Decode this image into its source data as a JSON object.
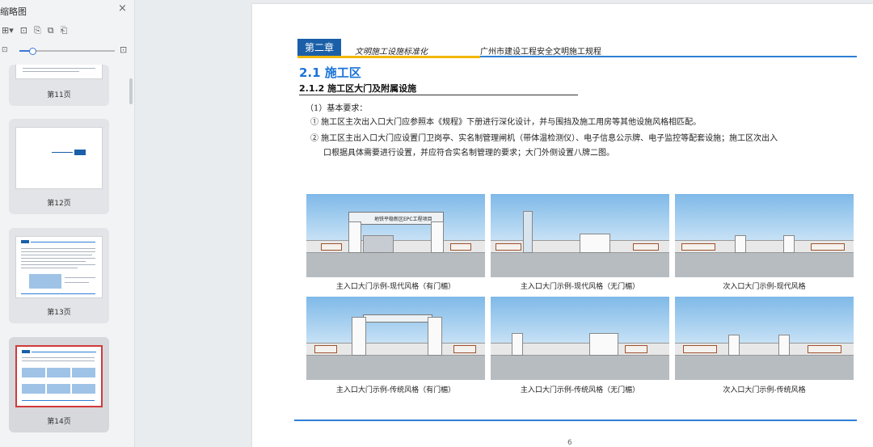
{
  "sidebar": {
    "title": "缩略图",
    "close": "×",
    "tools": [
      "⊞▾",
      "⊡",
      "⎘",
      "⧉",
      "⎗"
    ],
    "zoom_small_icon": "⊡",
    "zoom_large_icon": "⊡",
    "thumbnails": [
      {
        "label": "第11页"
      },
      {
        "label": "第12页"
      },
      {
        "label": "第13页"
      },
      {
        "label": "第14页"
      }
    ]
  },
  "document": {
    "chapter_box": "第二章",
    "chapter_tag": "文明施工设施标准化",
    "chapter_title": "广州市建设工程安全文明施工规程",
    "heading1": "2.1 施工区",
    "heading2": "2.1.2 施工区大门及附属设施",
    "basic_req": "（1）基本要求：",
    "item1": "① 施工区主次出入口大门应参照本《规程》下册进行深化设计，并与围挡及施工用房等其他设施风格相匹配。",
    "item2_line1": "② 施工区主出入口大门应设置门卫岗亭、实名制管理闸机（带体温检测仪）、电子信息公示牌、电子监控等配套设施；施工区次出入",
    "item2_line2": "口根据具体需要进行设置，并应符合实名制管理的要求；大门外侧设置八牌二图。",
    "figure_sign": "地铁平稳新区EPC工程项目",
    "captions": [
      "主入口大门示例-现代风格（有门楣）",
      "主入口大门示例-现代风格（无门楣）",
      "次入口大门示例-现代风格",
      "主入口大门示例-传统风格（有门楣）",
      "主入口大门示例-传统风格（无门楣）",
      "次入口大门示例-传统风格"
    ],
    "page_number": "6"
  }
}
